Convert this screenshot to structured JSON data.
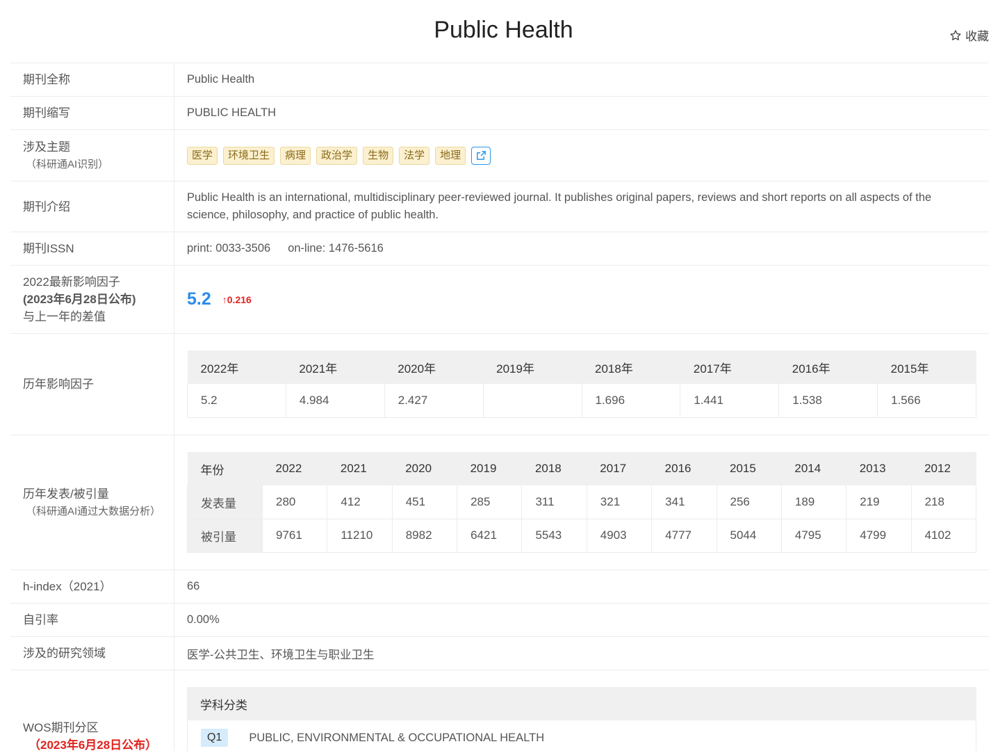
{
  "header": {
    "title": "Public Health",
    "favorite_label": "收藏"
  },
  "full_name": {
    "label": "期刊全称",
    "value": "Public Health"
  },
  "abbr": {
    "label": "期刊缩写",
    "value": "PUBLIC HEALTH"
  },
  "topics": {
    "label": "涉及主题",
    "sub": "（科研通AI识别）",
    "tags": [
      "医学",
      "环境卫生",
      "病理",
      "政治学",
      "生物",
      "法学",
      "地理"
    ]
  },
  "intro": {
    "label": "期刊介绍",
    "text": "Public Health is an international, multidisciplinary peer-reviewed journal. It publishes original papers, reviews and short reports on all aspects of the science, philosophy, and practice of public health."
  },
  "issn": {
    "label": "期刊ISSN",
    "print": "print: 0033-3506",
    "online": "on-line: 1476-5616"
  },
  "impact": {
    "label1": "2022最新影响因子",
    "label2": "(2023年6月28日公布)",
    "label3": "与上一年的差值",
    "value": "5.2",
    "delta": "↑0.216"
  },
  "history_if": {
    "label": "历年影响因子",
    "years": [
      "2022年",
      "2021年",
      "2020年",
      "2019年",
      "2018年",
      "2017年",
      "2016年",
      "2015年"
    ],
    "values": [
      "5.2",
      "4.984",
      "2.427",
      "",
      "1.696",
      "1.441",
      "1.538",
      "1.566"
    ]
  },
  "pubs": {
    "label": "历年发表/被引量",
    "sub": "（科研通AI通过大数据分析）",
    "year_header": "年份",
    "years": [
      "2022",
      "2021",
      "2020",
      "2019",
      "2018",
      "2017",
      "2016",
      "2015",
      "2014",
      "2013",
      "2012"
    ],
    "published_label": "发表量",
    "published": [
      "280",
      "412",
      "451",
      "285",
      "311",
      "321",
      "341",
      "256",
      "189",
      "219",
      "218"
    ],
    "cited_label": "被引量",
    "cited": [
      "9761",
      "11210",
      "8982",
      "6421",
      "5543",
      "4903",
      "4777",
      "5044",
      "4795",
      "4799",
      "4102"
    ]
  },
  "hindex": {
    "label": "h-index（2021）",
    "value": "66"
  },
  "self_cite": {
    "label": "自引率",
    "value": "0.00%"
  },
  "fields": {
    "label": "涉及的研究领域",
    "value": "医学-公共卫生、环境卫生与职业卫生"
  },
  "wos": {
    "label": "WOS期刊分区",
    "sub": "（2023年6月28日公布）",
    "head": "学科分类",
    "quartile": "Q1",
    "category": "PUBLIC, ENVIRONMENTAL & OCCUPATIONAL HEALTH"
  }
}
